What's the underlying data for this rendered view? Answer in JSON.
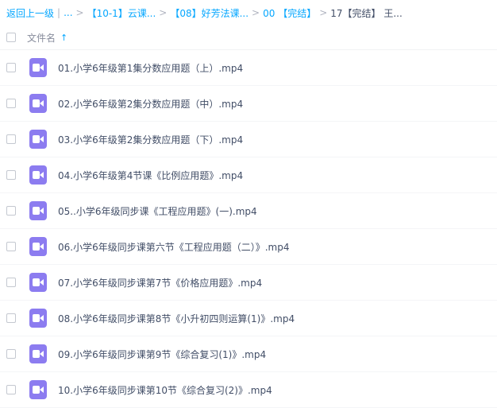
{
  "breadcrumb": {
    "back": "返回上一级",
    "sep1": "|",
    "ellipsis": "...",
    "items": [
      "【10-1】云课...",
      "【08】好芳法课...",
      "00 【完结】"
    ],
    "current": "17【完结】 王..."
  },
  "header": {
    "column_label": "文件名"
  },
  "files": [
    "01.小学6年级第1集分数应用题（上）.mp4",
    "02.小学6年级第2集分数应用题（中）.mp4",
    "03.小学6年级第2集分数应用题（下）.mp4",
    "04.小学6年级第4节课《比例应用题》.mp4",
    "05..小学6年级同步课《工程应用题》(一).mp4",
    "06.小学6年级同步课第六节《工程应用题（二）》.mp4",
    "07.小学6年级同步课第7节《价格应用题》.mp4",
    "08.小学6年级同步课第8节《小升初四则运算(1)》.mp4",
    "09.小学6年级同步课第9节《综合复习(1)》.mp4",
    "10.小学6年级同步课第10节《综合复习(2)》.mp4"
  ],
  "colors": {
    "accent": "#06a7ff",
    "video_icon": "#8c7cf0"
  },
  "icons": {
    "file": "video-file-icon",
    "sort": "sort-ascending-arrow-icon"
  }
}
